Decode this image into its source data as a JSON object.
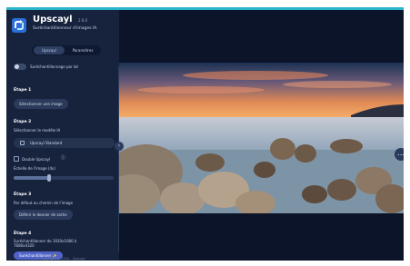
{
  "app": {
    "title": "Upscayl",
    "version": "2.8.0",
    "subtitle": "Suréchantillonneur d'images IA"
  },
  "tabs": [
    {
      "label": "Upscayl"
    },
    {
      "label": "Paramètres"
    }
  ],
  "batch": {
    "label": "Suréchantillonnage par lot"
  },
  "steps": {
    "step1": {
      "title": "Étape 1",
      "button": "Sélectionner une image"
    },
    "step2": {
      "title": "Étape 2",
      "desc": "Sélectionner le modèle IA",
      "model": "Upscayl Standard",
      "double_label": "Double Upscayl",
      "scale_label": "Échelle de l'image (4x)",
      "scale_fraction": 0.35
    },
    "step3": {
      "title": "Étape 3",
      "desc": "Par défaut au chemin de l'image",
      "button": "Définir le dossier de sortie"
    },
    "step4": {
      "title": "Étape 4",
      "desc": "Suréchantillonner de 1920x1080 à 7680x4320",
      "button": "Suréchantillonner ✨"
    }
  },
  "footer": {
    "text": "Copyright © 2024 - Upscayl"
  },
  "colors": {
    "accent": "#4f63c7",
    "topbar": "#2bb3c9",
    "sidebar": "#17233d",
    "canvas": "#0b1428"
  },
  "icons": [
    "upscayl-logo-icon",
    "model-icon",
    "info-icon",
    "collapse-icon",
    "more-icon"
  ]
}
